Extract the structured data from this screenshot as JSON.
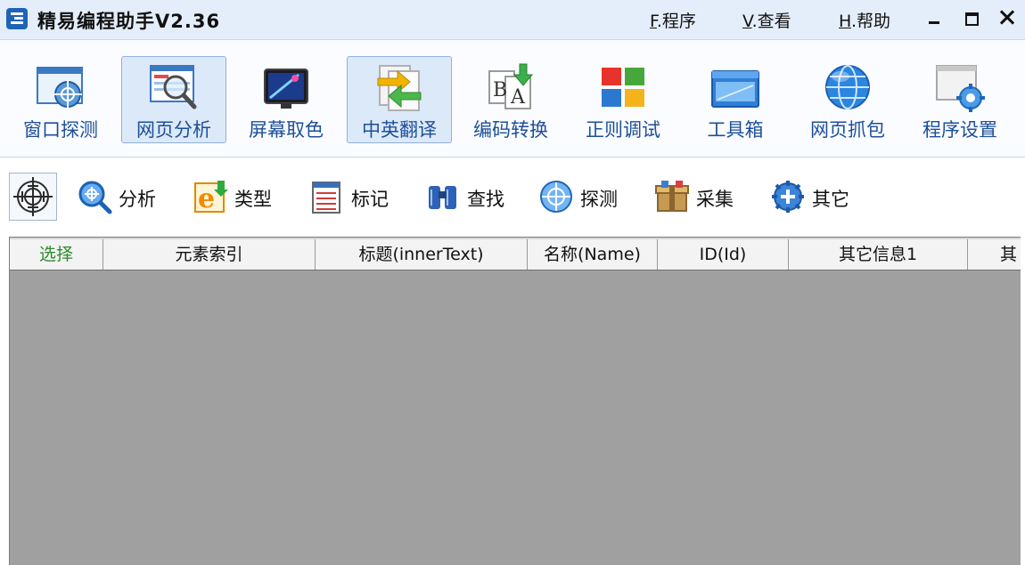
{
  "app": {
    "title": "精易编程助手V2.36"
  },
  "menu": [
    {
      "key": "F",
      "label": ".程序"
    },
    {
      "key": "V",
      "label": ".查看"
    },
    {
      "key": "H",
      "label": ".帮助"
    }
  ],
  "toolbar": {
    "active": [
      "网页分析",
      "中英翻译"
    ],
    "items": [
      {
        "label": "窗口探测",
        "icon": "window-target-icon"
      },
      {
        "label": "网页分析",
        "icon": "magnifier-page-icon"
      },
      {
        "label": "屏幕取色",
        "icon": "color-picker-icon"
      },
      {
        "label": "中英翻译",
        "icon": "translate-arrows-icon"
      },
      {
        "label": "编码转换",
        "icon": "encoding-convert-icon"
      },
      {
        "label": "正则调试",
        "icon": "regex-tiles-icon"
      },
      {
        "label": "工具箱",
        "icon": "toolbox-icon"
      },
      {
        "label": "网页抓包",
        "icon": "globe-icon"
      },
      {
        "label": "程序设置",
        "icon": "settings-gear-icon"
      }
    ]
  },
  "subtoolbar": {
    "items": [
      {
        "label": "分析",
        "icon": "analyze-magnifier-icon"
      },
      {
        "label": "类型",
        "icon": "ie-type-icon"
      },
      {
        "label": "标记",
        "icon": "mark-list-icon"
      },
      {
        "label": "查找",
        "icon": "binoculars-icon"
      },
      {
        "label": "探测",
        "icon": "crosshair-icon"
      },
      {
        "label": "采集",
        "icon": "collect-box-icon"
      },
      {
        "label": "其它",
        "icon": "other-plus-gear-icon"
      }
    ]
  },
  "grid": {
    "columns": [
      "选择",
      "元素索引",
      "标题(innerText)",
      "名称(Name)",
      "ID(Id)",
      "其它信息1",
      "其"
    ],
    "rows": []
  },
  "colors": {
    "titlebar": "#e4eefa",
    "toolbar_label": "#1d4f9a",
    "select_column": "#2d8b2d",
    "grid_empty": "#a0a0a0"
  }
}
